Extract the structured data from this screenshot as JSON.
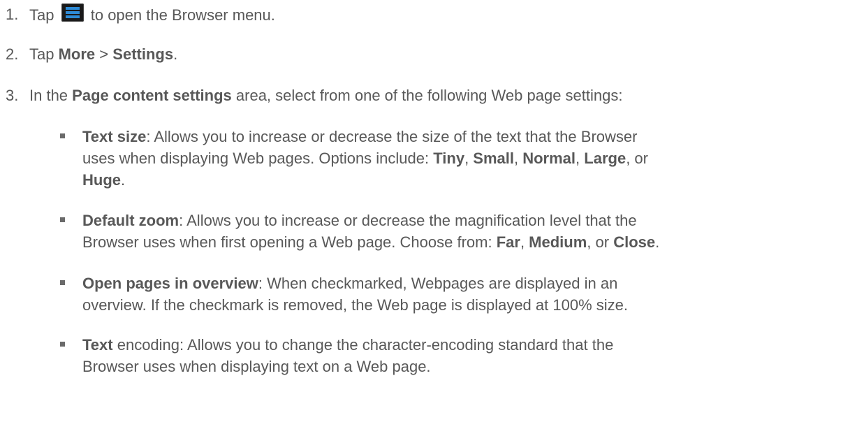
{
  "steps": [
    {
      "num": "1.",
      "pre": "Tap",
      "icon": "menu-icon",
      "post": "to open the Browser menu."
    },
    {
      "num": "2.",
      "pre": "Tap",
      "b1": "More",
      "mid": ">",
      "b2": "Settings",
      "post": "."
    },
    {
      "num": "3.",
      "pre": "In the",
      "b1": "Page content settings",
      "post": "area, select from one of the following Web page settings:"
    }
  ],
  "bullets": [
    {
      "term": "Text size",
      "l1": ": Allows you to increase or decrease the size of the text that the Browser",
      "l2a": "uses when displaying Web pages. Options include: ",
      "opts": [
        "Tiny",
        "Small",
        "Normal",
        "Large",
        "Huge"
      ]
    },
    {
      "term": "Default zoom",
      "l1": ": Allows you to increase or decrease the magnification level that the",
      "l2a": "Browser uses when first opening a Web page. Choose from: ",
      "opts": [
        "Far",
        "Medium",
        "Close"
      ]
    },
    {
      "term": "Open pages in overview",
      "l1": ": When checkmarked, Webpages are displayed in an",
      "l2": "overview. If the checkmark is removed, the Web page is displayed at 100% size."
    },
    {
      "term": "Text",
      "l1": " encoding: Allows you to change the character-encoding standard that the",
      "l2": "Browser uses when displaying text on a Web page."
    }
  ],
  "sep": {
    "comma": ", ",
    "or": ", or ",
    "period": "."
  }
}
